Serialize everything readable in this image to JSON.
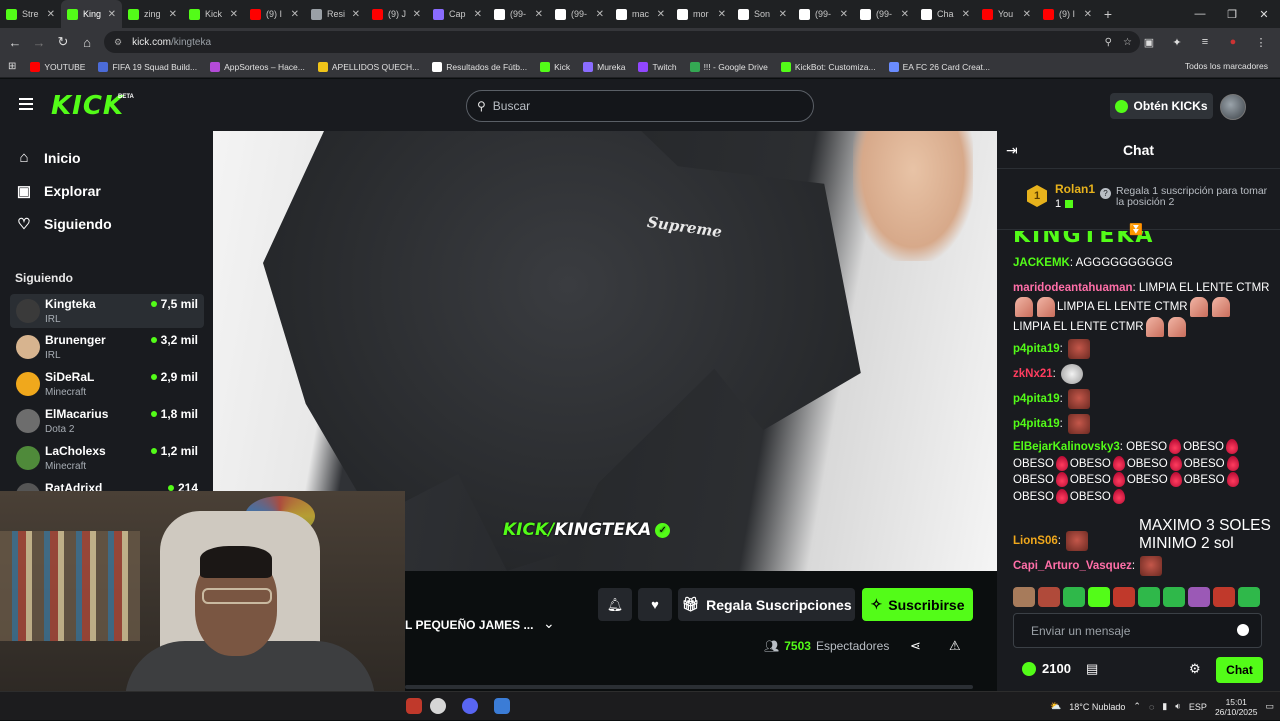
{
  "browser": {
    "tabs": [
      {
        "label": "Stre",
        "color": "#53fc18"
      },
      {
        "label": "King",
        "color": "#53fc18",
        "active": true
      },
      {
        "label": "zing",
        "color": "#53fc18"
      },
      {
        "label": "Kick",
        "color": "#53fc18"
      },
      {
        "label": "(9) I",
        "color": "#ff0000"
      },
      {
        "label": "Resi",
        "color": "#9aa0a6"
      },
      {
        "label": "(9) J",
        "color": "#ff0000"
      },
      {
        "label": "Cap",
        "color": "#8a6cff"
      },
      {
        "label": "(99-",
        "color": "#ffffff"
      },
      {
        "label": "(99-",
        "color": "#ffffff"
      },
      {
        "label": "mac",
        "color": "#ffffff"
      },
      {
        "label": "mor",
        "color": "#ffffff"
      },
      {
        "label": "Son",
        "color": "#ffffff"
      },
      {
        "label": "(99-",
        "color": "#ffffff"
      },
      {
        "label": "(99-",
        "color": "#ffffff"
      },
      {
        "label": "Cha",
        "color": "#ffffff"
      },
      {
        "label": "You",
        "color": "#ff0000"
      },
      {
        "label": "(9) I",
        "color": "#ff0000"
      }
    ],
    "url_host": "kick.com",
    "url_path": "/kingteka",
    "bookmarks": [
      {
        "label": "YOUTUBE",
        "color": "#ff0000"
      },
      {
        "label": "FIFA 19 Squad Build...",
        "color": "#4b6bd8"
      },
      {
        "label": "AppSorteos – Hace...",
        "color": "#b44bd8"
      },
      {
        "label": "APELLIDOS QUECH...",
        "color": "#f0c419"
      },
      {
        "label": "Resultados de Fútb...",
        "color": "#ffffff"
      },
      {
        "label": "Kick",
        "color": "#53fc18"
      },
      {
        "label": "Mureka",
        "color": "#8a6cff"
      },
      {
        "label": "Twitch",
        "color": "#9146ff"
      },
      {
        "label": "!!! - Google Drive",
        "color": "#34a853"
      },
      {
        "label": "KickBot: Customiza...",
        "color": "#53fc18"
      },
      {
        "label": "EA FC 26 Card Creat...",
        "color": "#6a8cff"
      }
    ],
    "bookmarks_all": "Todos los marcadores"
  },
  "header": {
    "logo": "KICK",
    "beta": "BETA",
    "search_placeholder": "Buscar",
    "kicks_button": "Obtén KICKs"
  },
  "sidebar": {
    "nav": [
      {
        "label": "Inicio",
        "icon": "home-icon"
      },
      {
        "label": "Explorar",
        "icon": "explore-icon"
      },
      {
        "label": "Siguiendo",
        "icon": "heart-icon"
      }
    ],
    "following_title": "Siguiendo",
    "channels": [
      {
        "name": "Kingteka",
        "category": "IRL",
        "viewers": "7,5 mil",
        "avatar": "#3a3a3a"
      },
      {
        "name": "Brunenger",
        "category": "IRL",
        "viewers": "3,2 mil",
        "avatar": "#d7b48f"
      },
      {
        "name": "SiDeRaL",
        "category": "Minecraft",
        "viewers": "2,9 mil",
        "avatar": "#f0a81c"
      },
      {
        "name": "ElMacarius",
        "category": "Dota 2",
        "viewers": "1,8 mil",
        "avatar": "#6d6d6d"
      },
      {
        "name": "LaCholexs",
        "category": "Minecraft",
        "viewers": "1,2 mil",
        "avatar": "#4f8a3a"
      },
      {
        "name": "RatAdrixd",
        "category": "",
        "viewers": "214",
        "avatar": "#555555"
      }
    ]
  },
  "video": {
    "shirt_text": "Supreme",
    "watermark_kick": "KICK/",
    "watermark_channel": "KINGTEKA"
  },
  "stream_info": {
    "title_truncated": "L PEQUEÑO JAMES ...",
    "gift_button": "Regala Suscripciones",
    "subscribe_button": "Suscribirse",
    "viewers_count": "7503",
    "viewers_label": "Espectadores"
  },
  "chat": {
    "title": "Chat",
    "leader": {
      "rank": "1",
      "name": "Rolan1",
      "count": "1"
    },
    "gift_hint": "Regala 1 suscripción para tomar la posición 2",
    "pinned_fragment": "KINGTEKA",
    "messages": [
      {
        "user": "JACKEMK",
        "color": "#53fc18",
        "text": "AGGGGGGGGGG"
      },
      {
        "user": "maridodeantahuaman",
        "color": "#ff6fa8",
        "text": "LIMPIA EL LENTE CTMR",
        "text2": "LIMPIA EL LENTE CTMR",
        "text3": "LIMPIA EL LENTE CTMR"
      },
      {
        "user": "p4pita19",
        "color": "#53fc18",
        "text": ""
      },
      {
        "user": "zkNx21",
        "color": "#ff3d5f",
        "text": ""
      },
      {
        "user": "p4pita19",
        "color": "#53fc18",
        "text": ""
      },
      {
        "user": "p4pita19",
        "color": "#53fc18",
        "text": ""
      },
      {
        "user": "ElBejarKalinovsky3",
        "color": "#53fc18",
        "text": "OBESO"
      },
      {
        "user": "LionS06",
        "color": "#f0a81c",
        "text": ""
      },
      {
        "user": "Capi_Arturo_Vasquez",
        "color": "#ff6fa8",
        "text": ""
      }
    ],
    "obeso_word": "OBESO",
    "overlay_line1": "MAXIMO 3 SOLES",
    "overlay_line2": "MINIMO 2 sol",
    "input_placeholder": "Enviar un mensaje",
    "points": "2100",
    "send_button": "Chat"
  },
  "taskbar": {
    "weather": "18°C Nublado",
    "lang": "ESP",
    "time": "15:01",
    "date": "26/10/2025"
  }
}
